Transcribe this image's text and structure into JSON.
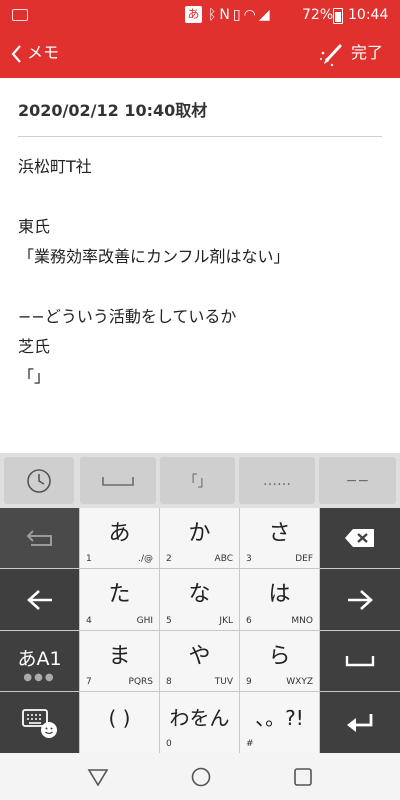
{
  "status": {
    "ime": "あ",
    "battery": "72%",
    "time": "10:44"
  },
  "appbar": {
    "back_label": "メモ",
    "done_label": "完了"
  },
  "memo": {
    "title": "2020/02/12 10:40取材",
    "lines": [
      "浜松町T社",
      "",
      "東氏",
      "「業務効率改善にカンフル剤はない」",
      "",
      "−−どういう活動をしているか",
      "芝氏",
      "「」"
    ]
  },
  "candidates": {
    "bracket": "「」",
    "ellipsis": "……",
    "dash": "−−"
  },
  "keyboard": {
    "rows": [
      [
        {
          "kana": "あ",
          "num": "1",
          "sub": "./@"
        },
        {
          "kana": "か",
          "num": "2",
          "sub": "ABC"
        },
        {
          "kana": "さ",
          "num": "3",
          "sub": "DEF"
        }
      ],
      [
        {
          "kana": "た",
          "num": "4",
          "sub": "GHI"
        },
        {
          "kana": "な",
          "num": "5",
          "sub": "JKL"
        },
        {
          "kana": "は",
          "num": "6",
          "sub": "MNO"
        }
      ],
      [
        {
          "kana": "ま",
          "num": "7",
          "sub": "PQRS"
        },
        {
          "kana": "や",
          "num": "8",
          "sub": "TUV"
        },
        {
          "kana": "ら",
          "num": "9",
          "sub": "WXYZ"
        }
      ],
      [
        {
          "kana": "( )",
          "num": "",
          "sub": ""
        },
        {
          "kana": "わをん",
          "num": "0",
          "sub": ""
        },
        {
          "kana": "、。?!",
          "num": "#",
          "sub": ""
        }
      ]
    ],
    "mode_label": "あA1"
  },
  "colors": {
    "accent": "#e0312f",
    "key_dark": "#3f3f3f",
    "key_light": "#f6f6f6"
  }
}
